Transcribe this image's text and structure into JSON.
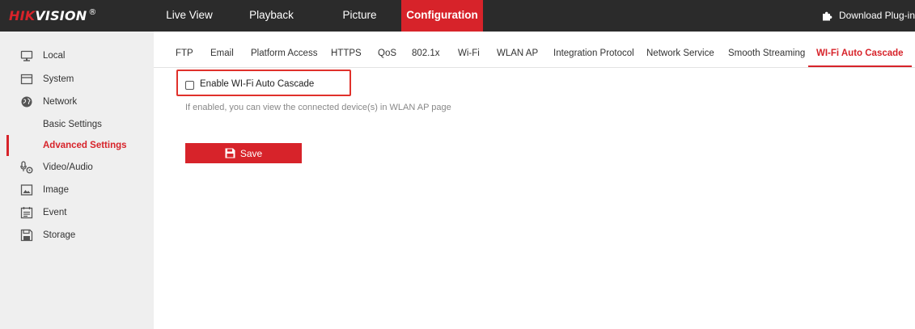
{
  "brand": {
    "logo_hik": "HIK",
    "logo_vision": "VISION",
    "logo_reg": "®",
    "accent_color": "#d7232a",
    "topbar_color": "#2b2b2b"
  },
  "topnav": {
    "items": [
      {
        "label": "Live View",
        "active": false
      },
      {
        "label": "Playback",
        "active": false
      },
      {
        "label": "Picture",
        "active": false
      },
      {
        "label": "Configuration",
        "active": true
      }
    ],
    "download": {
      "icon": "puzzle-icon",
      "label": "Download Plug-in"
    }
  },
  "sidebar": {
    "items": [
      {
        "label": "Local",
        "icon": "monitor-icon"
      },
      {
        "label": "System",
        "icon": "system-icon"
      },
      {
        "label": "Network",
        "icon": "globe-icon"
      },
      {
        "label": "Basic Settings",
        "sub": true
      },
      {
        "label": "Advanced Settings",
        "sub": true,
        "active": true
      },
      {
        "label": "Video/Audio",
        "icon": "video-audio-icon"
      },
      {
        "label": "Image",
        "icon": "image-icon"
      },
      {
        "label": "Event",
        "icon": "event-icon"
      },
      {
        "label": "Storage",
        "icon": "storage-icon"
      }
    ]
  },
  "tabs": [
    {
      "label": "FTP"
    },
    {
      "label": "Email"
    },
    {
      "label": "Platform Access"
    },
    {
      "label": "HTTPS"
    },
    {
      "label": "QoS"
    },
    {
      "label": "802.1x"
    },
    {
      "label": "Wi-Fi"
    },
    {
      "label": "WLAN AP"
    },
    {
      "label": "Integration Protocol"
    },
    {
      "label": "Network Service"
    },
    {
      "label": "Smooth Streaming"
    },
    {
      "label": "WI-Fi Auto Cascade",
      "active": true
    }
  ],
  "content": {
    "enable_label": "Enable WI-Fi Auto Cascade",
    "enable_checked": false,
    "hint": "If enabled, you can view the connected device(s) in WLAN AP page",
    "save_label": "Save",
    "save_icon": "floppy-disk-icon"
  }
}
